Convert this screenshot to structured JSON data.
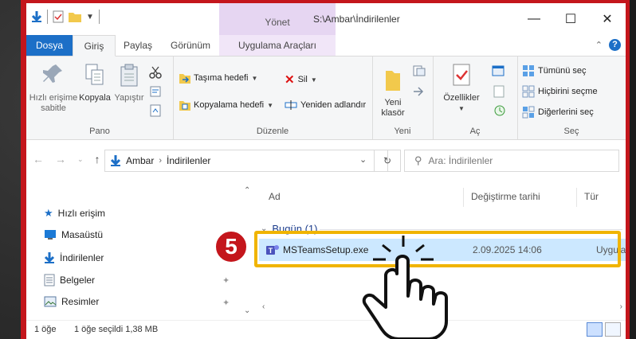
{
  "window": {
    "context_tab_title": "Yönet",
    "path_title": "S:\\Ambar\\İndirilenler",
    "minimize": "—",
    "maximize": "☐",
    "close": "✕"
  },
  "tabs": [
    {
      "label": "Dosya"
    },
    {
      "label": "Giriş"
    },
    {
      "label": "Paylaş"
    },
    {
      "label": "Görünüm"
    },
    {
      "label": "Uygulama Araçları"
    }
  ],
  "ribbon": {
    "pano": {
      "name": "Pano",
      "pin_label": "Hızlı erişime sabitle",
      "copy_label": "Kopyala",
      "paste_label": "Yapıştır"
    },
    "duzenle": {
      "name": "Düzenle",
      "move_label": "Taşıma hedefi",
      "copyto_label": "Kopyalama hedefi",
      "delete_label": "Sil",
      "rename_label": "Yeniden adlandır"
    },
    "yeni": {
      "name": "Yeni",
      "newfolder_label": "Yeni klasör"
    },
    "ac": {
      "name": "Aç",
      "properties_label": "Özellikler"
    },
    "sec": {
      "name": "Seç",
      "selectall_label": "Tümünü seç",
      "selectnone_label": "Hiçbirini seçme",
      "invert_label": "Diğerlerini seç"
    }
  },
  "address": {
    "crumb_root": "Ambar",
    "crumb_current": "İndirilenler",
    "search_placeholder": "Ara: İndirilenler"
  },
  "nav": {
    "items": [
      {
        "label": "Hızlı erişim"
      },
      {
        "label": "Masaüstü"
      },
      {
        "label": "İndirilenler"
      },
      {
        "label": "Belgeler"
      },
      {
        "label": "Resimler"
      }
    ]
  },
  "filelist": {
    "columns": {
      "name": "Ad",
      "modified": "Değiştirme tarihi",
      "type": "Tür"
    },
    "group_label": "Bugün (1)",
    "row": {
      "name": "MSTeamsSetup.exe",
      "modified": "2.09.2025 14:06",
      "type": "Uygular"
    }
  },
  "step_badge": "5",
  "status": {
    "count": "1 öğe",
    "selected": "1 öğe seçildi 1,38 MB"
  },
  "colors": {
    "frame": "#c4161c",
    "highlight": "#f0b400",
    "accent": "#1c6fc7",
    "selection": "#cce8ff"
  }
}
